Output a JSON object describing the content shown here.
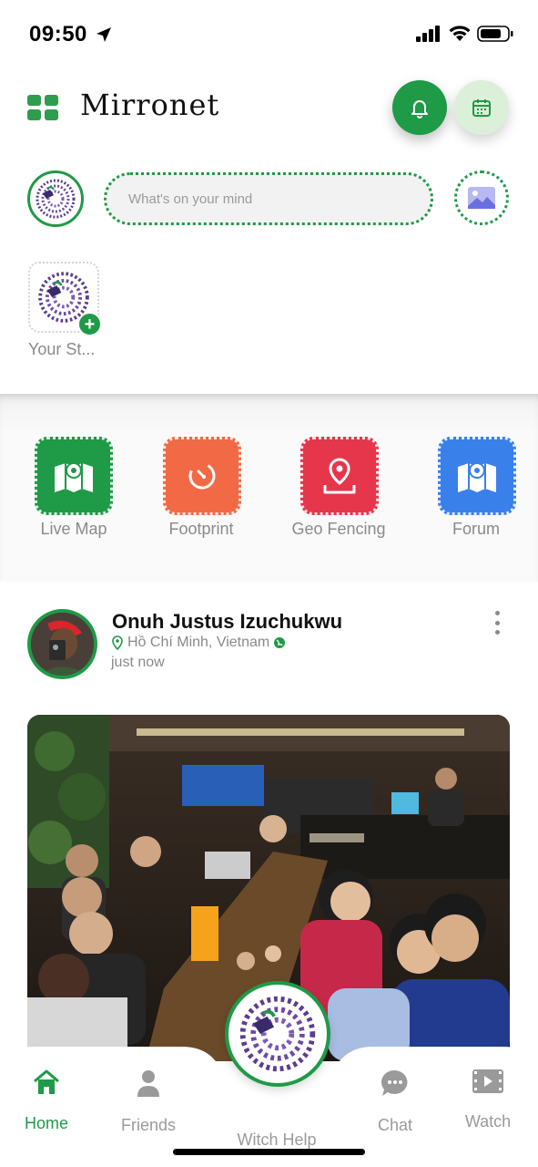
{
  "status_bar": {
    "time": "09:50"
  },
  "header": {
    "brand": "Mirronet"
  },
  "composer": {
    "placeholder": "What's on your mind"
  },
  "story": {
    "label": "Your St..."
  },
  "shortcuts": [
    {
      "label": "Live Map",
      "color": "#1f9a47",
      "icon": "map-icon"
    },
    {
      "label": "Footprint",
      "color": "#f26a45",
      "icon": "timer-icon"
    },
    {
      "label": "Geo Fencing",
      "color": "#e6364c",
      "icon": "location-pin-icon"
    },
    {
      "label": "Forum",
      "color": "#3a80ea",
      "icon": "map-pin-icon"
    }
  ],
  "post": {
    "author": "Onuh Justus Izuchukwu",
    "location": "Hồ Chí Minh, Vietnam",
    "time": "just now"
  },
  "bottom_nav": {
    "items": [
      {
        "label": "Home",
        "icon": "home-icon",
        "active": true
      },
      {
        "label": "Friends",
        "icon": "person-icon",
        "active": false
      },
      {
        "label": "Witch Help",
        "icon": "logo-icon",
        "active": false
      },
      {
        "label": "Chat",
        "icon": "chat-icon",
        "active": false
      },
      {
        "label": "Watch",
        "icon": "video-icon",
        "active": false
      }
    ]
  },
  "colors": {
    "accent": "#1f9a47",
    "accent_light": "#dcefd9",
    "muted": "#8a8a8a"
  }
}
